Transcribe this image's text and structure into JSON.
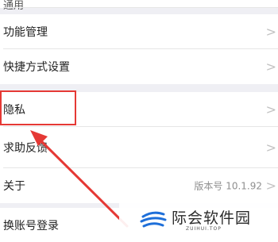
{
  "settings": {
    "items": [
      {
        "label": "通用"
      },
      {
        "label": "功能管理",
        "chevron": ">"
      },
      {
        "label": "快捷方式设置",
        "chevron": ">"
      },
      {
        "label": "隐私",
        "chevron": ">"
      },
      {
        "label": "求助反馈",
        "chevron": ">"
      },
      {
        "label": "关于",
        "value": "版本号 10.1.92",
        "chevron": ">"
      },
      {
        "label": "换账号登录"
      }
    ]
  },
  "annotation": {
    "highlight_color": "#e53935"
  },
  "watermark": {
    "title": "际会软件园",
    "subtitle": "ZUIHUI.TOP"
  }
}
